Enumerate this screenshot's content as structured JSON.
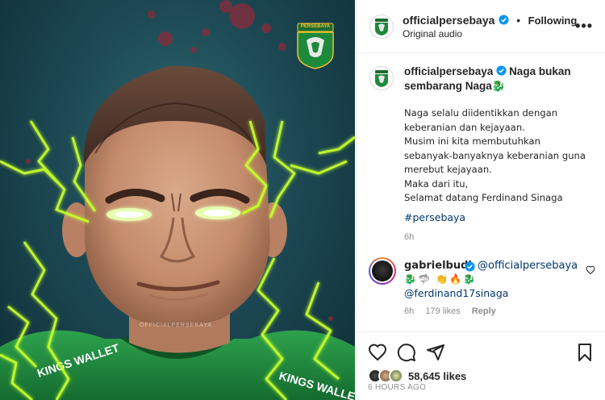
{
  "post": {
    "username": "officialpersebaya",
    "follow_state": "Following",
    "dot": "•",
    "audio": "Original audio",
    "more": "•••"
  },
  "caption": {
    "username": "officialpersebaya",
    "title_rest": "Naga bukan sembarang Naga🐉",
    "lines": [
      "Naga selalu diidentikkan dengan",
      "keberanian dan kejayaan.",
      "Musim ini kita membutuhkan",
      "sebanyak-banyaknya keberanian guna",
      "merebut kejayaan.",
      "Maka dari itu,",
      "Selamat datang Ferdinand Sinaga"
    ],
    "hashtag": "#persebaya",
    "time": "6h"
  },
  "comment": {
    "username": "gabrielbudi",
    "mention": "@officialpersebaya",
    "emojis": "🐉🦈 👏🔥🐉",
    "emojis_line2": "🐉🐲🐉🔥🐉",
    "mention2": "@ferdinand17sinaga",
    "time": "6h",
    "likes": "179 likes",
    "reply": "Reply"
  },
  "stats": {
    "likes": "58,645 likes",
    "ago": "6 HOURS AGO"
  },
  "media": {
    "badge_text": "PERSEBAYA",
    "watermark": "OFFICIALPERSEBAYA",
    "shirt_text_left": "KINGS WALLET",
    "shirt_text_right": "KINGS WALLE"
  },
  "colors": {
    "link": "#00376b",
    "verified": "#0095f6",
    "secondary": "#8e8e8e",
    "lightning": "#c6ff2e",
    "jersey": "#1f8a3c"
  }
}
